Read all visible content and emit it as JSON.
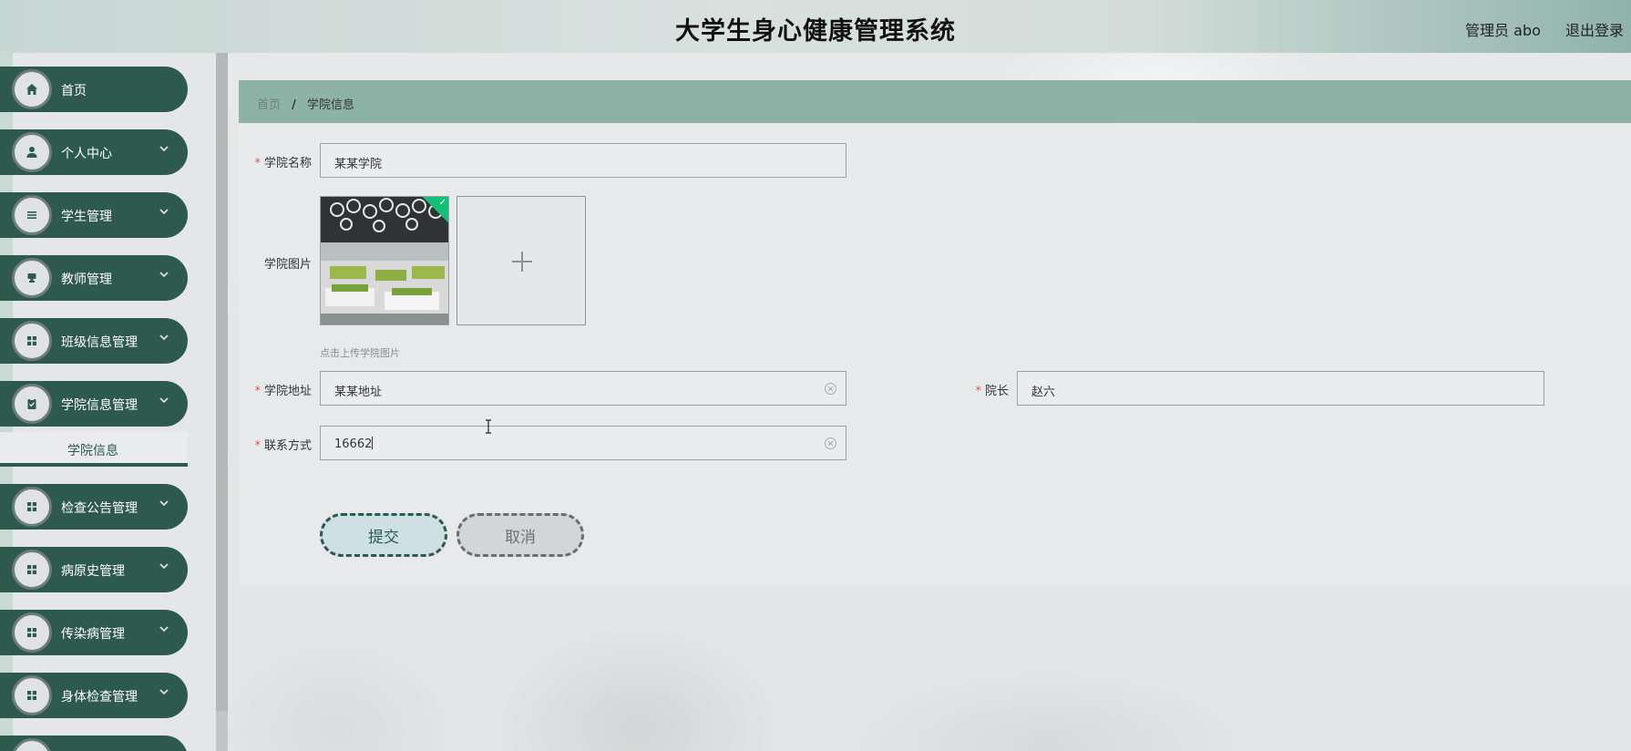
{
  "header": {
    "title": "大学生身心健康管理系统",
    "user": "管理员 abo",
    "logout": "退出登录"
  },
  "sidebar": {
    "items": [
      {
        "label": "首页",
        "icon": "home-icon"
      },
      {
        "label": "个人中心",
        "icon": "user-icon"
      },
      {
        "label": "学生管理",
        "icon": "list-icon"
      },
      {
        "label": "教师管理",
        "icon": "teacher-icon"
      },
      {
        "label": "班级信息管理",
        "icon": "grid-icon"
      },
      {
        "label": "学院信息管理",
        "icon": "clipboard-icon"
      },
      {
        "label": "检查公告管理",
        "icon": "grid-icon"
      },
      {
        "label": "病原史管理",
        "icon": "grid-icon"
      },
      {
        "label": "传染病管理",
        "icon": "grid-icon"
      },
      {
        "label": "身体检查管理",
        "icon": "grid-icon"
      }
    ],
    "submenu_active": "学院信息"
  },
  "breadcrumb": {
    "home": "首页",
    "separator": "/",
    "current": "学院信息"
  },
  "form": {
    "college_name_label": "学院名称",
    "college_name_value": "某某学院",
    "college_image_label": "学院图片",
    "upload_tip": "点击上传学院图片",
    "address_label": "学院地址",
    "address_value": "某某地址",
    "dean_label": "院长",
    "dean_value": "赵六",
    "contact_label": "联系方式",
    "contact_value": "16662",
    "required_mark": "*"
  },
  "buttons": {
    "submit": "提交",
    "cancel": "取消"
  },
  "colors": {
    "primary": "#2e5a4e",
    "breadcrumb_bg": "#8db3a7",
    "required": "#e05b4b",
    "upload_success": "#13c07a"
  }
}
